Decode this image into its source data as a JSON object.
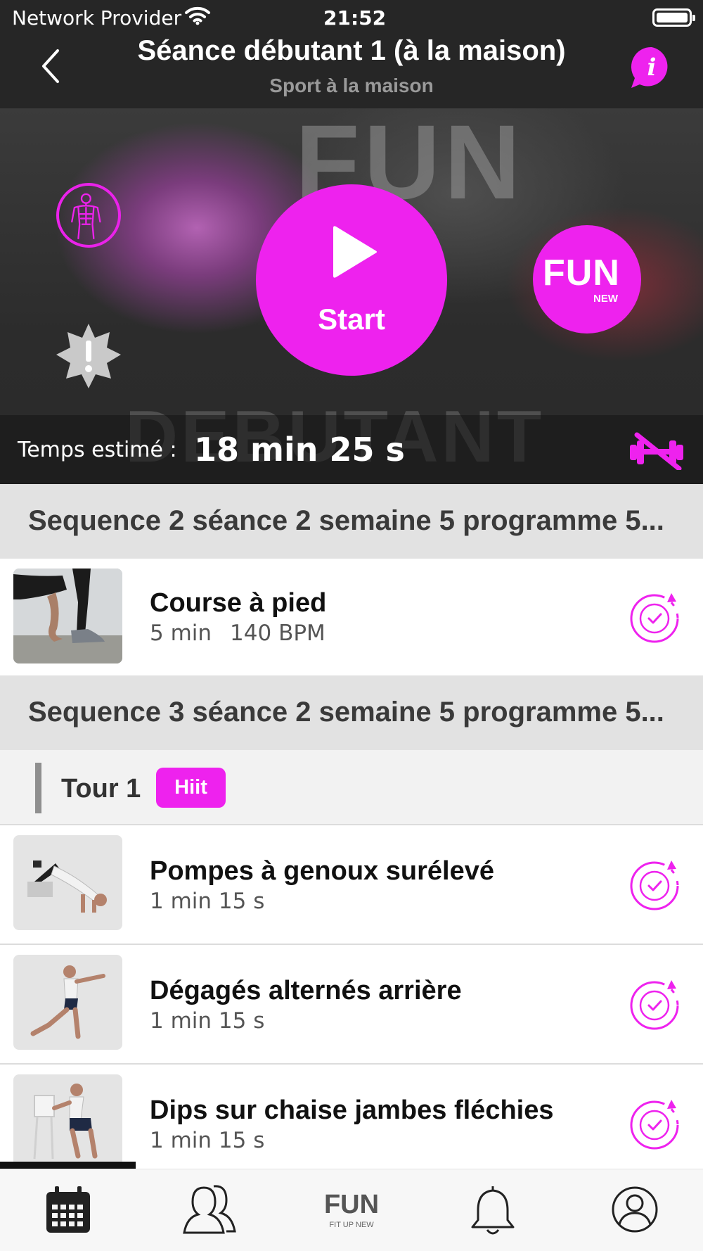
{
  "status_bar": {
    "carrier": "Network Provider",
    "time": "21:52"
  },
  "nav": {
    "title": "Séance débutant 1 (à la maison)",
    "subtitle": "Sport à la maison",
    "info_label": "i"
  },
  "hero": {
    "background_text": "DEBUTANT",
    "background_logo_text": "FUN",
    "start_label": "Start",
    "logo_text": "FUN",
    "logo_subtext": "NEW",
    "estimated_label": "Temps estimé :",
    "estimated_value": "18 min 25 s"
  },
  "sequences": [
    {
      "title": "Sequence 2 séance 2 semaine 5 programme 5...",
      "exercises": [
        {
          "name": "Course à pied",
          "duration": "5 min",
          "bpm": "140 BPM"
        }
      ]
    },
    {
      "title": "Sequence 3 séance 2 semaine 5 programme 5...",
      "round": {
        "label": "Tour 1",
        "badge": "Hiit"
      },
      "exercises": [
        {
          "name": "Pompes à genoux surélevé",
          "duration": "1 min 15 s"
        },
        {
          "name": "Dégagés alternés arrière",
          "duration": "1 min 15 s"
        },
        {
          "name": "Dips sur chaise jambes fléchies",
          "duration": "1 min 15 s"
        }
      ]
    }
  ],
  "tabbar": {
    "icons": [
      "calendar-icon",
      "group-icon",
      "fun-logo-icon",
      "bell-icon",
      "profile-icon"
    ],
    "logo_text": "FUN",
    "logo_subtext": "FIT UP NEW"
  },
  "colors": {
    "accent": "#ee22ee",
    "nav_background": "#262626",
    "section_background": "#e2e2e2",
    "round_background": "#f2f2f2",
    "round_bar": "#8f8f8f"
  }
}
